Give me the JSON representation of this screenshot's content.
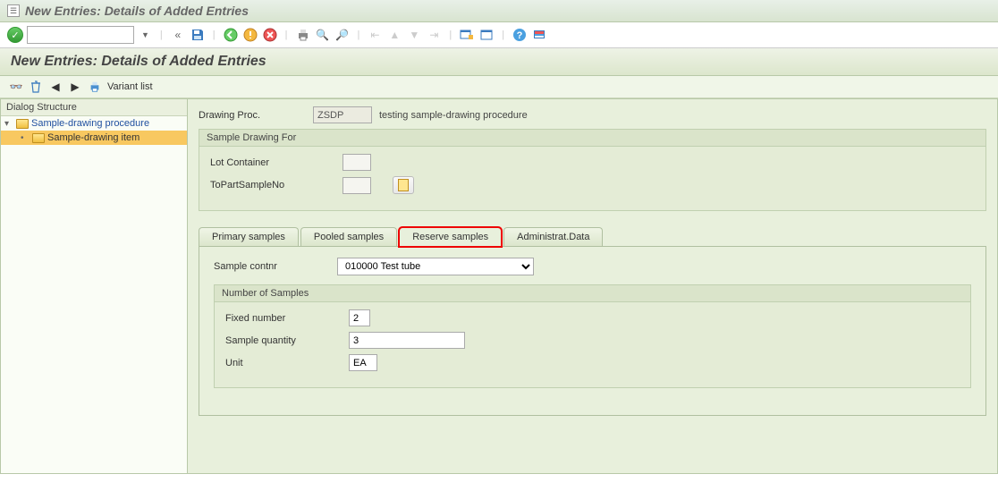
{
  "window": {
    "title": "New Entries: Details of Added Entries"
  },
  "subtitle": "New Entries: Details of Added Entries",
  "appbar": {
    "variant_list": "Variant list"
  },
  "dialog_structure": {
    "title": "Dialog Structure",
    "items": [
      {
        "label": "Sample-drawing procedure",
        "expanded": true
      },
      {
        "label": "Sample-drawing item",
        "selected": true
      }
    ]
  },
  "header": {
    "drawing_proc_label": "Drawing Proc.",
    "drawing_proc_value": "ZSDP",
    "drawing_proc_desc": "testing sample-drawing procedure"
  },
  "group1": {
    "title": "Sample Drawing For",
    "lot_container_label": "Lot Container",
    "lot_container_value": "",
    "topart_label": "ToPartSampleNo",
    "topart_value": ""
  },
  "tabs": [
    {
      "label": "Primary samples"
    },
    {
      "label": "Pooled samples"
    },
    {
      "label": "Reserve samples",
      "active": true,
      "highlighted": true
    },
    {
      "label": "Administrat.Data"
    }
  ],
  "tab_content": {
    "sample_contnr_label": "Sample contnr",
    "sample_contnr_value": "010000 Test tube",
    "group_title": "Number of Samples",
    "fixed_number_label": "Fixed number",
    "fixed_number_value": "2",
    "sample_qty_label": "Sample quantity",
    "sample_qty_value": "3",
    "unit_label": "Unit",
    "unit_value": "EA"
  }
}
